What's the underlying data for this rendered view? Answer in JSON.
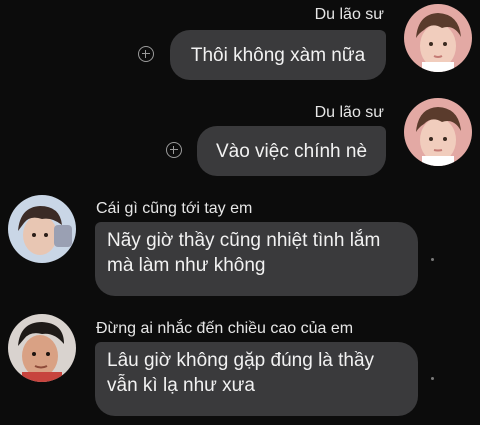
{
  "messages": [
    {
      "sender": "Du lão sư",
      "text": "Thôi không xàm nữa",
      "direction": "outgoing"
    },
    {
      "sender": "Du lão sư",
      "text": "Vào việc chính nè",
      "direction": "outgoing"
    },
    {
      "sender": "Cái gì cũng tới tay em",
      "text": "Nãy giờ thầy cũng nhiệt tình lắm\nmà làm như không",
      "direction": "incoming"
    },
    {
      "sender": "Đừng ai nhắc đến chiều cao của em",
      "text": "Lâu giờ không gặp đúng là thầy\nvẫn kì lạ như xưa",
      "direction": "incoming"
    }
  ],
  "icons": {
    "react": "add-reaction-icon"
  },
  "colors": {
    "background": "#0c0c0c",
    "bubble": "#3a3a3c",
    "text": "#f2f2f2"
  }
}
